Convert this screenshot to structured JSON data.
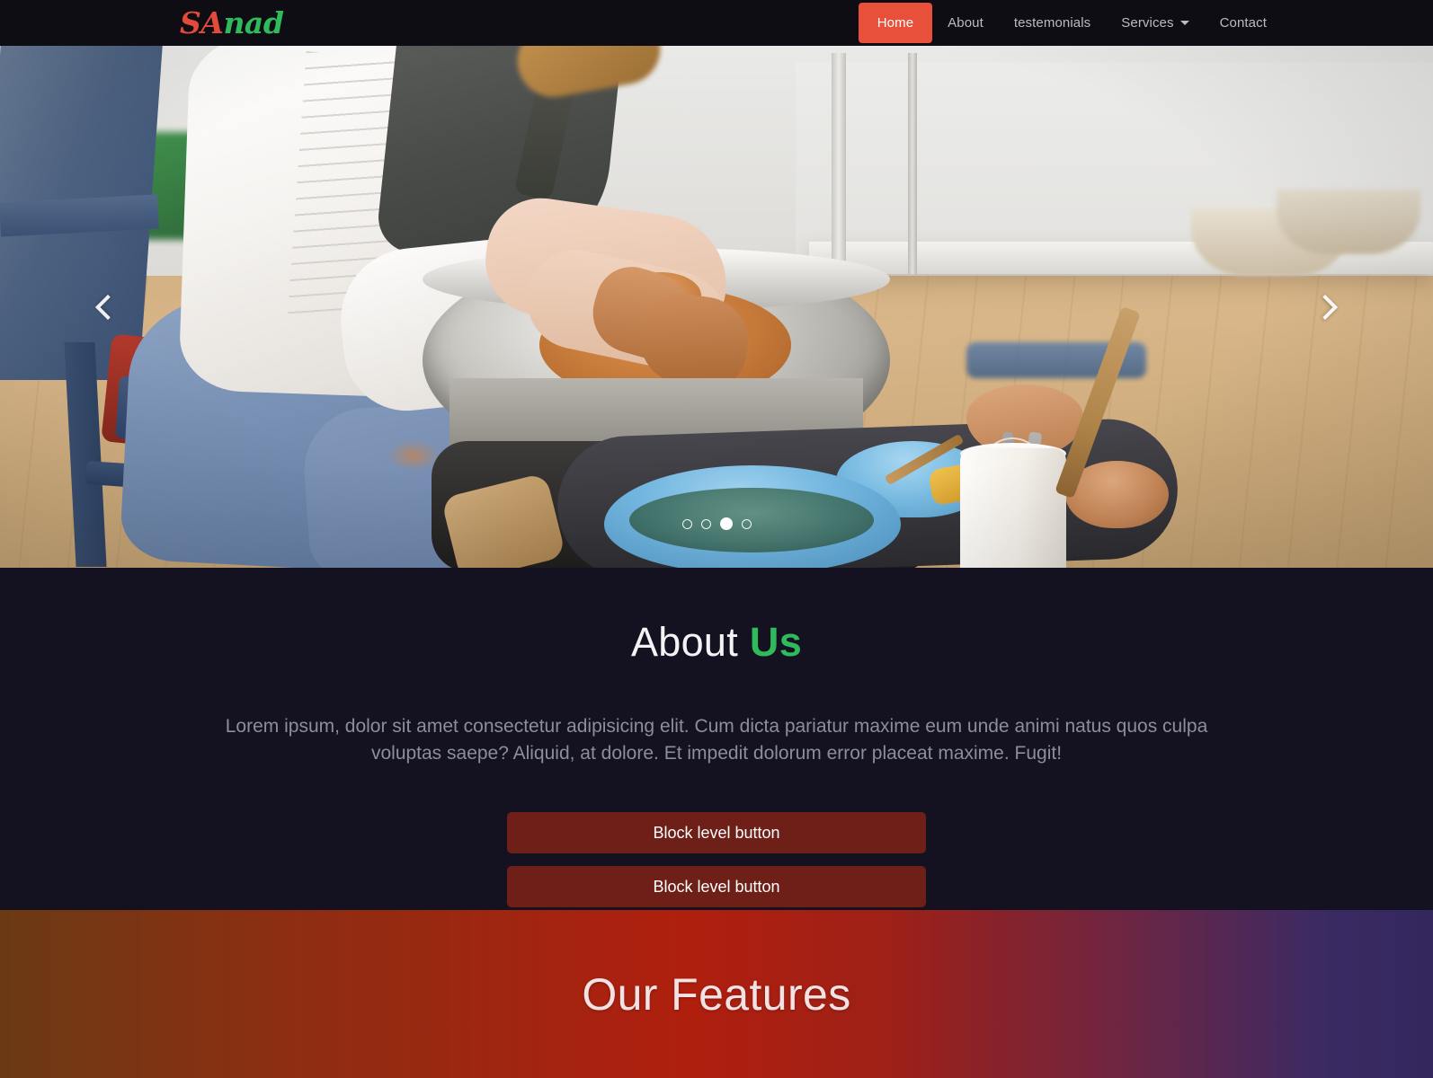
{
  "navbar": {
    "brand": {
      "part1": "SA",
      "part2": "nad"
    },
    "items": [
      {
        "label": "Home",
        "active": true
      },
      {
        "label": "About",
        "active": false
      },
      {
        "label": "testemonials",
        "active": false
      },
      {
        "label": "Services",
        "active": false,
        "has_caret": true
      },
      {
        "label": "Contact",
        "active": false
      }
    ],
    "background_color": "#0e0d14",
    "active_color": "#e8503c"
  },
  "hero": {
    "image_description": "Woman in white blouse and jeans sitting on a blue wooden chair throwing clay on a pottery wheel, with blue bowls, terracotta bowls and wooden tools on a dark tray",
    "prev_label": "Previous",
    "next_label": "Next",
    "slide_count": 4,
    "active_slide": 3
  },
  "about": {
    "title_main": "About",
    "title_accent": "Us",
    "accent_color": "#2fba5c",
    "paragraph": "Lorem ipsum, dolor sit amet consectetur adipisicing elit. Cum dicta pariatur maxime eum unde animi natus quos culpa voluptas saepe? Aliquid, at dolore. Et impedit dolorum error placeat maxime. Fugit!",
    "buttons": [
      {
        "label": "Block level button"
      },
      {
        "label": "Block level button"
      }
    ],
    "button_color": "#6e1f17",
    "background_color": "#141120"
  },
  "features": {
    "title": "Our Features",
    "gradient_from": "#6a3a14",
    "gradient_mid": "#b01f0e",
    "gradient_to": "#33275e"
  }
}
